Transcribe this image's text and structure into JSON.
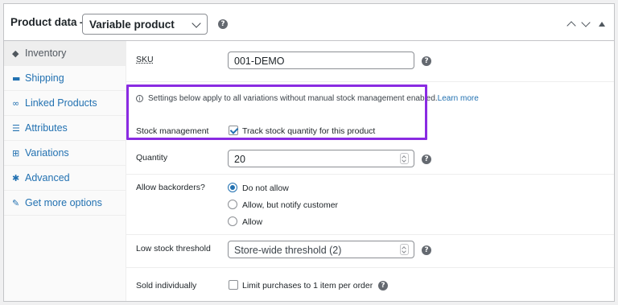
{
  "header": {
    "title": "Product data —",
    "product_type": "Variable product",
    "help_icon": "?",
    "controls": [
      "chevron-up-icon",
      "chevron-down-icon",
      "triangle-up-icon"
    ]
  },
  "sidebar": {
    "items": [
      {
        "label": "Inventory",
        "icon": "tag-icon",
        "glyph": "◆"
      },
      {
        "label": "Shipping",
        "icon": "truck-icon",
        "glyph": "▬"
      },
      {
        "label": "Linked Products",
        "icon": "link-icon",
        "glyph": "∞"
      },
      {
        "label": "Attributes",
        "icon": "list-icon",
        "glyph": "☰"
      },
      {
        "label": "Variations",
        "icon": "grid-icon",
        "glyph": "⊞"
      },
      {
        "label": "Advanced",
        "icon": "gear-icon",
        "glyph": "✱"
      },
      {
        "label": "Get more options",
        "icon": "plugin-icon",
        "glyph": "✎"
      }
    ]
  },
  "inventory": {
    "sku_label": "SKU",
    "sku_value": "001-DEMO",
    "notice_text": "Settings below apply to all variations without manual stock management enabled.",
    "learn_more": "Learn more",
    "stock_label": "Stock management",
    "stock_checkbox_label": "Track stock quantity for this product",
    "stock_checked": true,
    "quantity_label": "Quantity",
    "quantity_value": "20",
    "backorders_label": "Allow backorders?",
    "backorder_options": [
      "Do not allow",
      "Allow, but notify customer",
      "Allow"
    ],
    "backorder_selected": "Do not allow",
    "low_stock_label": "Low stock threshold",
    "low_stock_placeholder": "Store-wide threshold (2)",
    "sold_individually_label": "Sold individually",
    "sold_individually_checkbox": "Limit purchases to 1 item per order",
    "sold_individually_checked": false
  },
  "colors": {
    "accent": "#2271b1",
    "highlight_border": "#8a2be2"
  }
}
